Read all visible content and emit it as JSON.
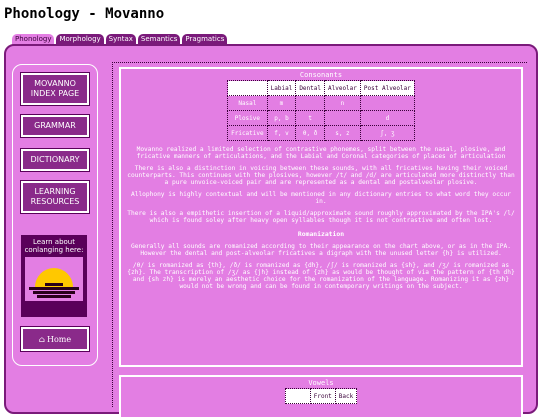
{
  "page": {
    "title": "Phonology - Movanno"
  },
  "tabs": [
    {
      "label": "Phonology",
      "active": true
    },
    {
      "label": "Morphology"
    },
    {
      "label": "Syntax"
    },
    {
      "label": "Semantics"
    },
    {
      "label": "Pragmatics"
    }
  ],
  "sidebar": {
    "index_button": "MOVANNO INDEX PAGE",
    "grammar_button": "GRAMMAR",
    "dictionary_button": "DICTIONARY",
    "learning_button": "LEARNING RESOURCES",
    "promo_text": "Learn about conlanging here:",
    "home_button": "Home",
    "home_icon": "home-icon"
  },
  "consonants": {
    "title": "Consonants",
    "headers": [
      "",
      "Labial",
      "Dental",
      "Alveolar",
      "Post Alveolar"
    ],
    "rows": [
      {
        "label": "Nasal",
        "cells": [
          "m",
          "",
          "n",
          ""
        ]
      },
      {
        "label": "Plosive",
        "cells": [
          "p, b",
          "t",
          "",
          "d"
        ]
      },
      {
        "label": "Fricative",
        "cells": [
          "f, v",
          "θ, ð",
          "s, z",
          "ʃ, ʒ"
        ]
      }
    ],
    "paragraphs": [
      "Movanno realized a limited selection of contrastive phonemes, split between the nasal, plosive, and fricative manners of articulations, and the Labial and Coronal categories of places of articulation",
      "There is also a distinction in voicing between these sounds, with all fricatives having their voiced counterparts. This continues with the plosives, however /t/ and /d/ are articulated more distinctly than a pure unvoice-voiced pair and are represented as a dental and postalveolar plosive.",
      "Allophony is highly contextual and will be mentioned in any dictionary entries to what word they occur in.",
      "There is also a empithetic insertion of a liquid/approximate sound roughly approximated by the IPA's /l/ which is found soley after heavy open syllables though it is not contrastive and often lost."
    ],
    "romanization_heading": "Romanization",
    "romanization_paragraphs": [
      "Generally all sounds are romanized according to their appearance on the chart above, or as in the IPA. However the dental and post-alveolar fricatives a digraph with the unused letter {h} is utilized.",
      "/θ/ is romanized as {th}, /ð/ is romanized as {dh}, /ʃ/ is romanized as {sh}, and /ʒ/ is romanized as {zh}. The transcription of /ʒ/ as {jh} instead of {zh} as would be thought of via the pattern of {th dh} and {sh zh} is merely an aesthetic choice for the romanization of the language. Romanizing it as {zh} would not be wrong and can be found in contemporary writings on the subject."
    ]
  },
  "vowels": {
    "title": "Vowels",
    "headers": [
      "",
      "Front",
      "Back"
    ]
  }
}
